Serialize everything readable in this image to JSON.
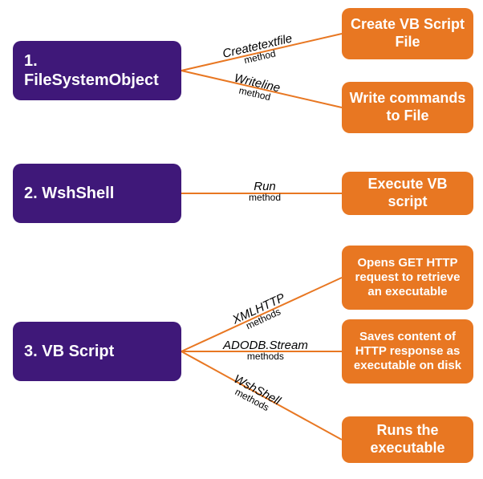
{
  "left": [
    {
      "id": "fso",
      "label": "1. FileSystemObject"
    },
    {
      "id": "wsh",
      "label": "2. WshShell"
    },
    {
      "id": "vbs",
      "label": "3. VB Script"
    }
  ],
  "right": [
    {
      "id": "r1",
      "label": "Create VB Script File"
    },
    {
      "id": "r2",
      "label": "Write commands to File"
    },
    {
      "id": "r3",
      "label": "Execute VB script"
    },
    {
      "id": "r4",
      "label": "Opens GET HTTP request to retrieve an executable"
    },
    {
      "id": "r5",
      "label": "Saves content of HTTP response as executable on disk"
    },
    {
      "id": "r6",
      "label": "Runs the executable"
    }
  ],
  "edges": [
    {
      "id": "e1",
      "main": "Createtextfile",
      "sub": "method"
    },
    {
      "id": "e2",
      "main": "Writeline",
      "sub": "method"
    },
    {
      "id": "e3",
      "main": "Run",
      "sub": "method"
    },
    {
      "id": "e4",
      "main": "XMLHTTP",
      "sub": "methods"
    },
    {
      "id": "e5",
      "main": "ADODB.Stream",
      "sub": "methods"
    },
    {
      "id": "e6",
      "main": "WshShell",
      "sub": "methods"
    }
  ]
}
